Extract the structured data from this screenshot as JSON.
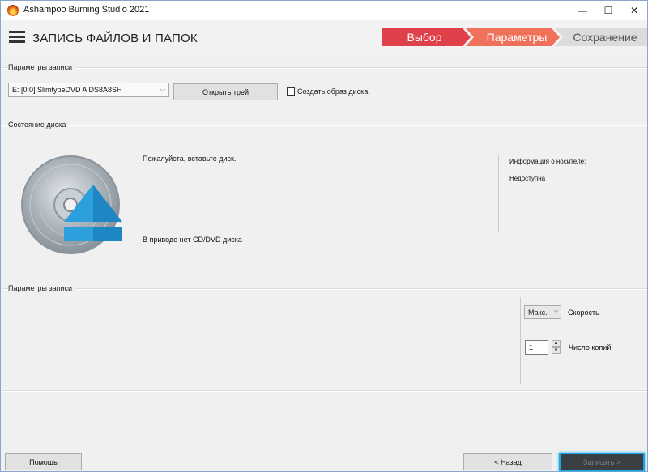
{
  "window": {
    "title": "Ashampoo Burning Studio 2021",
    "controls": {
      "minimize": "—",
      "maximize": "☐",
      "close": "✕"
    }
  },
  "header": {
    "title": "ЗАПИСЬ ФАЙЛОВ И ПАПОК",
    "steps": [
      {
        "label": "Выбор",
        "color": "#e0404a"
      },
      {
        "label": "Параметры",
        "color": "#f0715a"
      },
      {
        "label": "Сохранение",
        "color": "#dcdcdc"
      }
    ]
  },
  "record_params": {
    "group_title": "Параметры записи",
    "drive_select": "E: [0:0] SlimtypeDVD A DS8A8SH",
    "open_tray_label": "Открыть трей",
    "create_image_label": "Создать образ диска",
    "create_image_checked": false
  },
  "disc_state": {
    "group_title": "Состояние диска",
    "insert_prompt": "Пожалуйста, вставьте диск.",
    "no_disc_text": "В приводе нет CD/DVD диска",
    "media_info_label": "Информация о носителе:",
    "media_info_value": "Недоступна",
    "icon": "disc-eject-icon"
  },
  "write_params": {
    "group_title": "Параметры записи",
    "speed_value": "Макс.",
    "speed_label": "Скорость",
    "copies_value": "1",
    "copies_label": "Число копий"
  },
  "footer": {
    "help_label": "Помощь",
    "back_label": "< Назад",
    "burn_label": "Записать  >"
  },
  "colors": {
    "accent_focus": "#1aa6e4",
    "step_active": "#e0404a",
    "step_current": "#f0715a",
    "step_inactive": "#dcdcdc"
  }
}
